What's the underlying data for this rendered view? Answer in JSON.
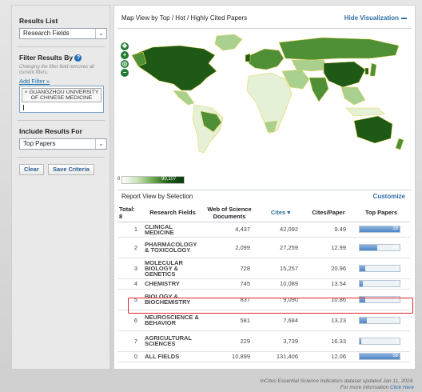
{
  "sidebar": {
    "results_list_title": "Results List",
    "results_list_value": "Research Fields",
    "filter_title": "Filter Results By",
    "filter_note": "Changing the filter field removes all current filters.",
    "add_filter": "Add Filter »",
    "filter_chip": "× GUANGZHOU UNIVERSITY OF CHINESE MEDICINE",
    "include_title": "Include Results For",
    "include_value": "Top Papers",
    "clear_label": "Clear",
    "save_label": "Save Criteria"
  },
  "visualization": {
    "title": "Map View by Top / Hot / Highly Cited Papers",
    "hide_label": "Hide Visualization",
    "legend_min": "0",
    "legend_max": "90,107",
    "colors": {
      "dark": "#1e5a16",
      "mid": "#4f8f36",
      "light": "#a9d08e",
      "pale": "#e4f1d6",
      "outline": "#e8d35a"
    }
  },
  "report": {
    "title": "Report View by Selection",
    "customize_label": "Customize",
    "headers": {
      "total_label": "Total:",
      "total_value": "8",
      "field": "Research Fields",
      "docs": "Web of Science Documents",
      "cites": "Cites",
      "cites_per_paper": "Cites/Paper",
      "top_papers": "Top Papers"
    },
    "rows": [
      {
        "idx": "1",
        "field": "CLINICAL MEDICINE",
        "docs": "4,437",
        "cites": "42,092",
        "cpp": "9.49",
        "top": "28",
        "top_frac": 1.0
      },
      {
        "idx": "2",
        "field": "PHARMACOLOGY & TOXICOLOGY",
        "docs": "2,099",
        "cites": "27,259",
        "cpp": "12.99",
        "top": "12",
        "top_frac": 0.43
      },
      {
        "idx": "3",
        "field": "MOLECULAR BIOLOGY & GENETICS",
        "docs": "728",
        "cites": "15,257",
        "cpp": "20.96",
        "top": "4",
        "top_frac": 0.14
      },
      {
        "idx": "4",
        "field": "CHEMISTRY",
        "docs": "745",
        "cites": "10,089",
        "cpp": "13.54",
        "top": "2",
        "top_frac": 0.07
      },
      {
        "idx": "5",
        "field": "BIOLOGY & BIOCHEMISTRY",
        "docs": "837",
        "cites": "9,090",
        "cpp": "10.86",
        "top": "4",
        "top_frac": 0.14
      },
      {
        "idx": "6",
        "field": "NEUROSCIENCE & BEHAVIOR",
        "docs": "581",
        "cites": "7,684",
        "cpp": "13.23",
        "top": "5",
        "top_frac": 0.18
      },
      {
        "idx": "7",
        "field": "AGRICULTURAL SCIENCES",
        "docs": "229",
        "cites": "3,739",
        "cpp": "16.33",
        "top": "1",
        "top_frac": 0.04
      },
      {
        "idx": "0",
        "field": "ALL FIELDS",
        "docs": "10,899",
        "cites": "131,406",
        "cpp": "12.06",
        "top": "56",
        "top_frac": 1.0
      }
    ]
  },
  "footer": {
    "line1": "InCites Essential Science Indicators dataset updated Jan 11, 2024.",
    "line2": "For more information",
    "link": "Click Here"
  }
}
